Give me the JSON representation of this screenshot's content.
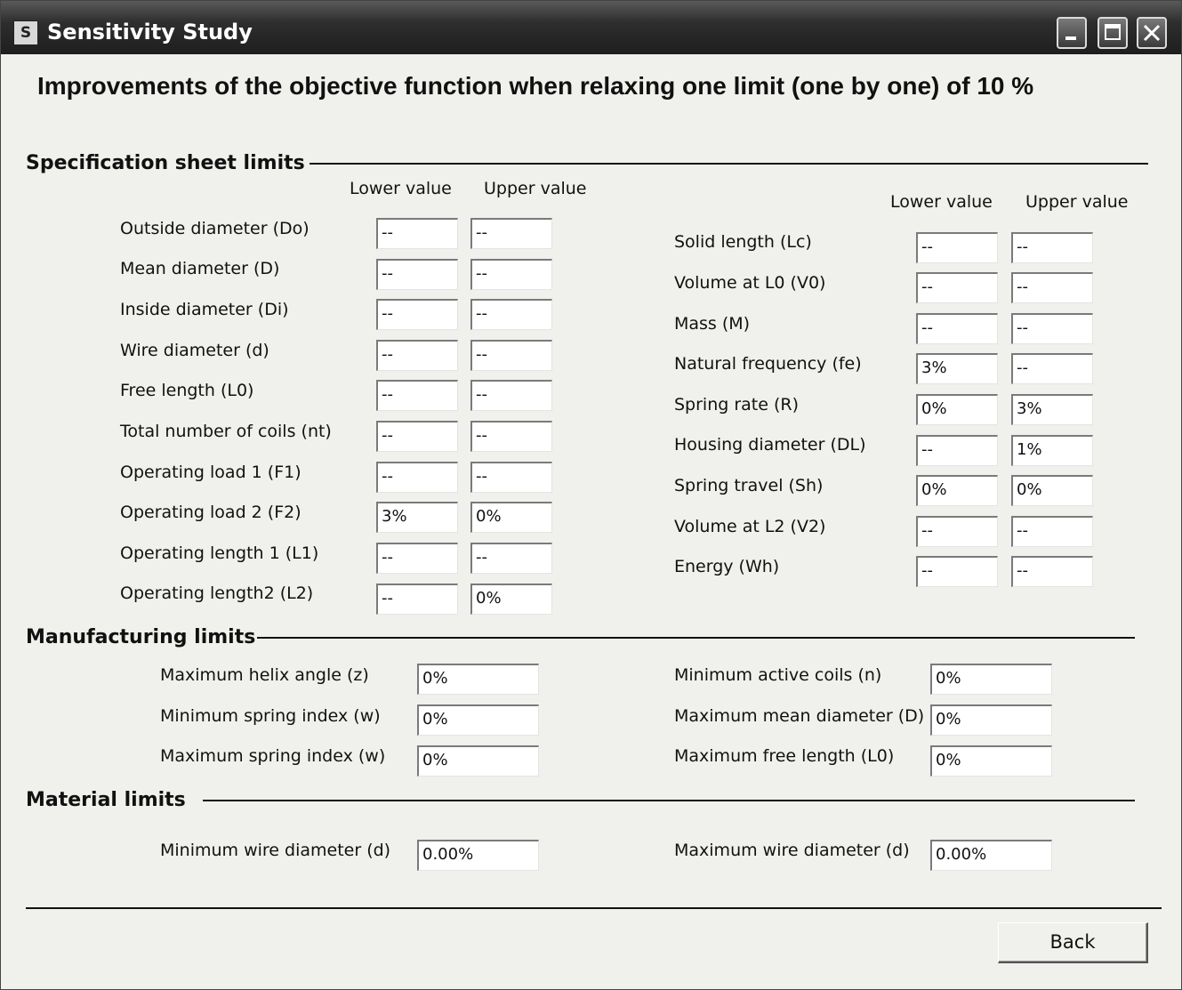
{
  "window": {
    "title": "Sensitivity Study",
    "icon": "app-icon"
  },
  "heading": "Improvements of the objective function  when relaxing one limit (one by one) of 10 %",
  "spec": {
    "title": "Specification sheet limits",
    "lower_header": "Lower value",
    "upper_header": "Upper value",
    "left": [
      {
        "label": "Outside diameter (Do)",
        "lower": "--",
        "upper": "--"
      },
      {
        "label": "Mean diameter (D)",
        "lower": "--",
        "upper": "--"
      },
      {
        "label": "Inside diameter (Di)",
        "lower": "--",
        "upper": "--"
      },
      {
        "label": "Wire diameter (d)",
        "lower": "--",
        "upper": "--"
      },
      {
        "label": "Free length (L0)",
        "lower": "--",
        "upper": "--"
      },
      {
        "label": "Total number of coils (nt)",
        "lower": "--",
        "upper": "--"
      },
      {
        "label": "Operating load 1 (F1)",
        "lower": "--",
        "upper": "--"
      },
      {
        "label": "Operating load 2 (F2)",
        "lower": "3%",
        "upper": "0%"
      },
      {
        "label": "Operating length 1 (L1)",
        "lower": "--",
        "upper": "--"
      },
      {
        "label": "Operating length2 (L2)",
        "lower": "--",
        "upper": "0%"
      }
    ],
    "right": [
      {
        "label": "Solid length (Lc)",
        "lower": "--",
        "upper": "--"
      },
      {
        "label": "Volume at L0 (V0)",
        "lower": "--",
        "upper": "--"
      },
      {
        "label": "Mass (M)",
        "lower": "--",
        "upper": "--"
      },
      {
        "label": "Natural frequency (fe)",
        "lower": "3%",
        "upper": "--"
      },
      {
        "label": "Spring rate (R)",
        "lower": "0%",
        "upper": "3%"
      },
      {
        "label": "Housing diameter (DL)",
        "lower": "--",
        "upper": "1%"
      },
      {
        "label": "Spring travel (Sh)",
        "lower": "0%",
        "upper": "0%"
      },
      {
        "label": "Volume at L2 (V2)",
        "lower": "--",
        "upper": "--"
      },
      {
        "label": "Energy (Wh)",
        "lower": "--",
        "upper": "--"
      }
    ]
  },
  "manufacturing": {
    "title": "Manufacturing limits",
    "left": [
      {
        "label": "Maximum helix angle (z)",
        "value": "0%"
      },
      {
        "label": "Minimum spring index (w)",
        "value": "0%"
      },
      {
        "label": "Maximum spring index (w)",
        "value": "0%"
      }
    ],
    "right": [
      {
        "label": "Minimum active coils (n)",
        "value": "0%"
      },
      {
        "label": "Maximum mean diameter (D)",
        "value": "0%"
      },
      {
        "label": "Maximum free length (L0)",
        "value": "0%"
      }
    ]
  },
  "material": {
    "title": "Material limits",
    "min_label": "Minimum wire diameter (d)",
    "min_value": "0.00%",
    "max_label": "Maximum wire diameter (d)",
    "max_value": "0.00%"
  },
  "back_button": "Back"
}
